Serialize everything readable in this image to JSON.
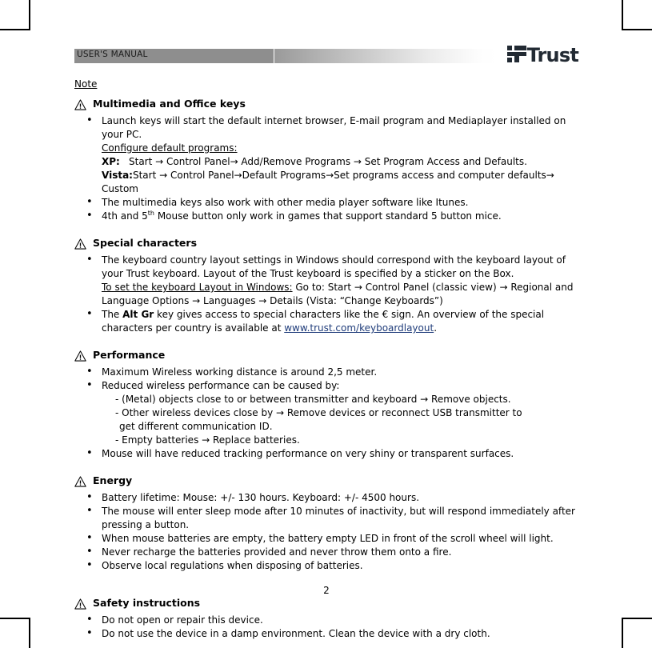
{
  "header": {
    "title": "USER'S MANUAL",
    "brand": "Trust",
    "brand_mark_icon": "trust-logo-mark"
  },
  "note_label": "Note",
  "warning_icon": "warning-triangle-icon",
  "link_color": "#1f3c7a",
  "header_bar_color": "#8e8e8e",
  "sections": [
    {
      "title": "Multimedia and Office keys",
      "bullets": [
        {
          "text": "Launch keys will start the default internet browser, E-mail program and Mediaplayer installed on your PC.",
          "sub": [
            {
              "text": "Configure default programs:",
              "style": "underline"
            },
            {
              "label": "XP:",
              "text": "Start → Control Panel→ Add/Remove Programs → Set Program Access and Defaults."
            },
            {
              "label": "Vista:",
              "text": "Start → Control Panel→Default Programs→Set programs access and computer defaults→ Custom"
            }
          ]
        },
        {
          "text": "The multimedia keys also work with other media player software like Itunes."
        },
        {
          "text_pre": "4th and 5",
          "sup": "th",
          "text_post": " Mouse button only work in games that support standard 5 button mice."
        }
      ]
    },
    {
      "title": "Special characters",
      "bullets": [
        {
          "text": "The keyboard country layout settings in Windows should correspond with the keyboard layout of your Trust keyboard.  Layout of the Trust keyboard is specified by a sticker on the Box.",
          "sub": [
            {
              "underline_part": "To set the keyboard Layout in Windows:",
              "text": "  Go to:  Start → Control Panel (classic view) → Regional and"
            },
            {
              "text": "Language Options → Languages → Details  (Vista: “Change Keyboards”)"
            }
          ]
        },
        {
          "text_pre": "The ",
          "bold": "Alt Gr",
          "text_post": " key gives access to special characters like the € sign. An overview of the special characters per country is available at ",
          "link": "www.trust.com/keyboardlayout",
          "text_end": "."
        }
      ]
    },
    {
      "title": "Performance",
      "bullets": [
        {
          "text": "Maximum Wireless working distance is around 2,5 meter."
        },
        {
          "text": "Reduced wireless performance can be caused by:",
          "sub": [
            {
              "text": "- (Metal) objects close to or between transmitter and keyboard → Remove objects.",
              "indent": "1"
            },
            {
              "text": "- Other wireless devices close by → Remove devices or reconnect USB transmitter to",
              "indent": "1"
            },
            {
              "text": "get different communication ID.",
              "indent": "2"
            },
            {
              "text": "- Empty batteries → Replace batteries.",
              "indent": "1"
            }
          ]
        },
        {
          "text": "Mouse will have reduced tracking performance on very shiny or transparent surfaces."
        }
      ]
    },
    {
      "title": "Energy",
      "bullets": [
        {
          "text": "Battery lifetime:  Mouse: +/- 130 hours.  Keyboard: +/- 4500 hours."
        },
        {
          "text": "The mouse will enter sleep mode after 10 minutes of inactivity, but will respond immediately after pressing a button."
        },
        {
          "text": "When mouse batteries are empty, the battery empty LED in front of the scroll wheel will light."
        },
        {
          "text": "Never recharge the batteries provided and never throw them onto a fire."
        },
        {
          "text": "Observe local regulations when disposing of batteries."
        }
      ]
    },
    {
      "title": "Safety instructions",
      "bullets": [
        {
          "text": "Do not open or repair this device."
        },
        {
          "text": "Do not use the device in a damp environment. Clean the device with a dry cloth."
        }
      ]
    }
  ],
  "page_number": "2"
}
